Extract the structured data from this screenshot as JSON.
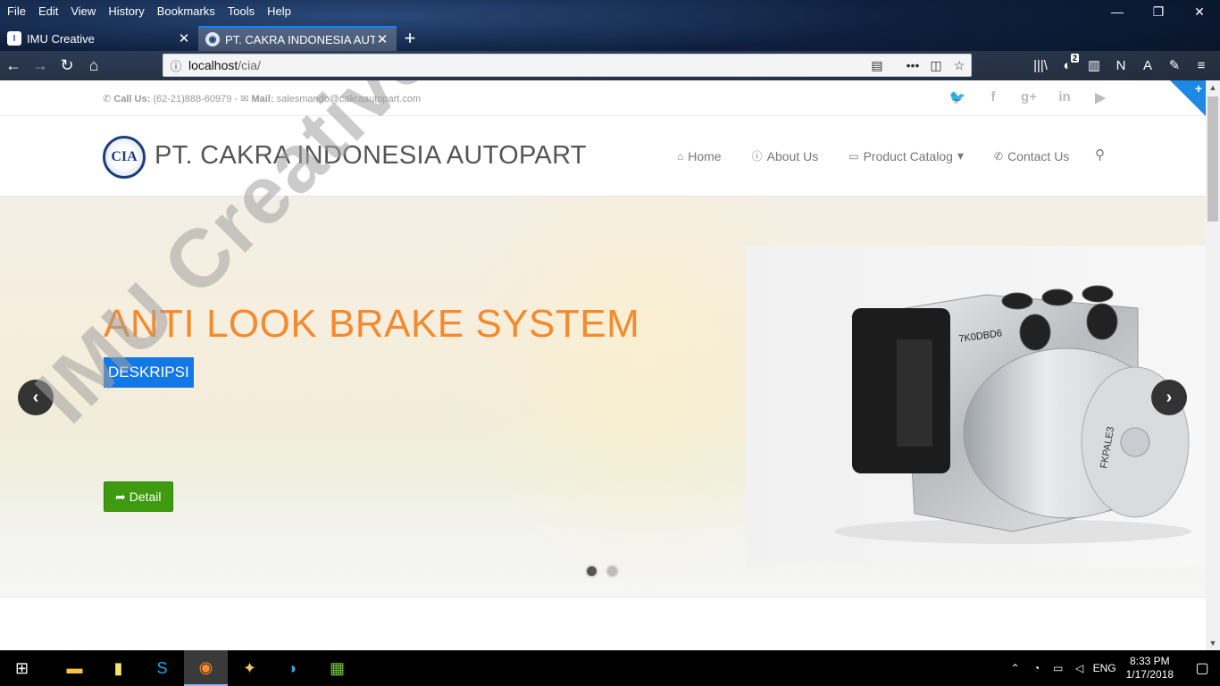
{
  "browser": {
    "menu": [
      "File",
      "Edit",
      "View",
      "History",
      "Bookmarks",
      "Tools",
      "Help"
    ],
    "window_controls": {
      "minimize": "—",
      "restore": "❐",
      "close": "✕"
    },
    "tabs": [
      {
        "title": "IMU Creative",
        "close": "✕"
      },
      {
        "title": "PT. CAKRA INDONESIA AUTOPART",
        "close": "✕"
      }
    ],
    "new_tab": "+",
    "url_host": "localhost",
    "url_path": "/cia/",
    "toolbar_badge": "2"
  },
  "topbar": {
    "call_label": "Call Us:",
    "phone": "(62-21)888-60979 -",
    "mail_label": "Mail:",
    "email": "salesmando@cakraautopart.com",
    "social": [
      "twitter-icon",
      "facebook-icon",
      "google-plus-icon",
      "linkedin-icon",
      "youtube-icon"
    ],
    "social_glyphs": [
      "🐦",
      "f",
      "g+",
      "in",
      "▶"
    ]
  },
  "header": {
    "logo_text": "CIA",
    "brand": "PT. CAKRA INDONESIA AUTOPART",
    "nav": [
      {
        "label": "Home",
        "icon": "⌂"
      },
      {
        "label": "About Us",
        "icon": "ⓘ"
      },
      {
        "label": "Product Catalog",
        "icon": "▭"
      },
      {
        "label": "Contact Us",
        "icon": "✆"
      }
    ],
    "caret": "▾",
    "search_glyph": "⚲"
  },
  "slider": {
    "title": "ANTI LOOK BRAKE SYSTEM",
    "description": "DESKRIPSI",
    "detail_label": "Detail",
    "prev": "‹",
    "next": "›",
    "active_slide": 1,
    "slide_count": 2
  },
  "watermark": "IMU Creative",
  "taskbar": {
    "time": "8:33 PM",
    "date": "1/17/2018",
    "lang": "ENG"
  },
  "colors": {
    "slide_title": "#f28a30",
    "desc_bg": "#1278e6",
    "detail_bg": "#3e9a0e",
    "ribbon": "#1e88e5"
  }
}
